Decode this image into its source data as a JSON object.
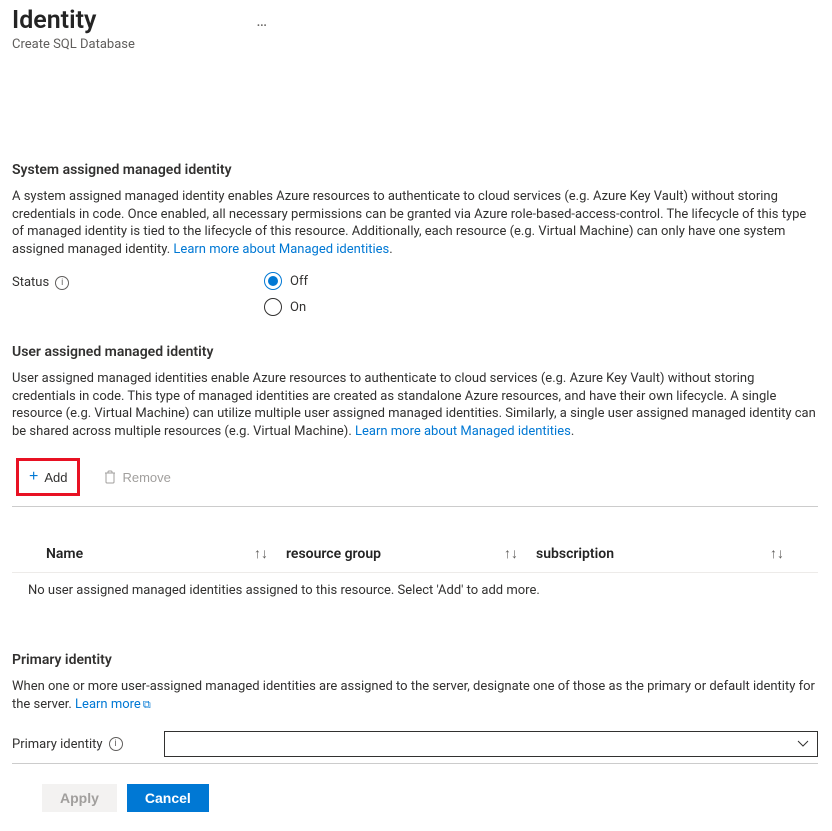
{
  "header": {
    "title": "Identity",
    "subtitle": "Create SQL Database",
    "more": "…"
  },
  "system": {
    "heading": "System assigned managed identity",
    "desc_part1": "A system assigned managed identity enables Azure resources to authenticate to cloud services (e.g. Azure Key Vault) without storing credentials in code. Once enabled, all necessary permissions can be granted via Azure role-based-access-control. The lifecycle of this type of managed identity is tied to the lifecycle of this resource. Additionally, each resource (e.g. Virtual Machine) can only have one system assigned managed identity. ",
    "learn_link": "Learn more about Managed identities",
    "status_label": "Status",
    "off": "Off",
    "on": "On"
  },
  "user": {
    "heading": "User assigned managed identity",
    "desc_part1": "User assigned managed identities enable Azure resources to authenticate to cloud services (e.g. Azure Key Vault) without storing credentials in code. This type of managed identities are created as standalone Azure resources, and have their own lifecycle. A single resource (e.g. Virtual Machine) can utilize multiple user assigned managed identities. Similarly, a single user assigned managed identity can be shared across multiple resources (e.g. Virtual Machine). ",
    "learn_link": "Learn more about Managed identities",
    "add": "Add",
    "remove": "Remove",
    "columns": {
      "name": "Name",
      "rg": "resource group",
      "sub": "subscription"
    },
    "empty": "No user assigned managed identities assigned to this resource. Select 'Add' to add more."
  },
  "primary": {
    "heading": "Primary identity",
    "desc_part1": "When one or more user-assigned managed identities are assigned to the server, designate one of those as the primary or default identity for the server. ",
    "learn_link": "Learn more",
    "field_label": "Primary identity"
  },
  "footer": {
    "apply": "Apply",
    "cancel": "Cancel"
  }
}
